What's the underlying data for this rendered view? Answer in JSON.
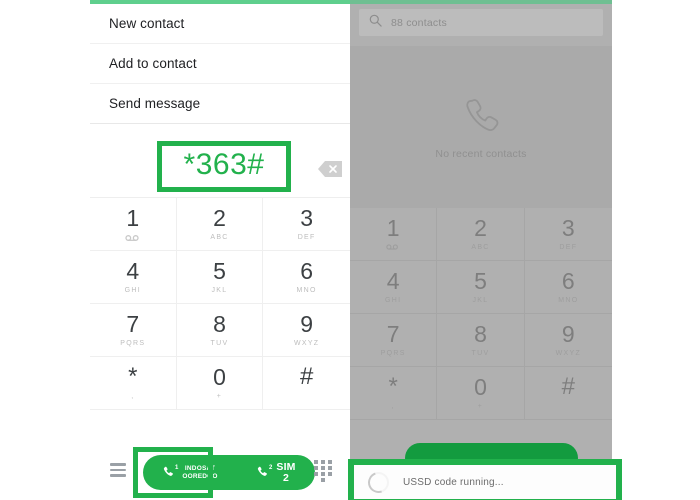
{
  "app": {
    "accent_green": "#22b14c",
    "top_strip_color": "#5fcf8d",
    "scrim_color": "#b0b0b0"
  },
  "suggestions": {
    "items": [
      {
        "label": "New contact"
      },
      {
        "label": "Add to contact"
      },
      {
        "label": "Send message"
      }
    ]
  },
  "number_display": {
    "value": "*363#",
    "backspace_icon": "backspace-icon"
  },
  "keypad": {
    "keys": [
      {
        "digit": "1",
        "sub": "",
        "voicemail": true
      },
      {
        "digit": "2",
        "sub": "ABC"
      },
      {
        "digit": "3",
        "sub": "DEF"
      },
      {
        "digit": "4",
        "sub": "GHI"
      },
      {
        "digit": "5",
        "sub": "JKL"
      },
      {
        "digit": "6",
        "sub": "MNO"
      },
      {
        "digit": "7",
        "sub": "PQRS"
      },
      {
        "digit": "8",
        "sub": "TUV"
      },
      {
        "digit": "9",
        "sub": "WXYZ"
      },
      {
        "digit": "*",
        "sub": ","
      },
      {
        "digit": "0",
        "sub": "+"
      },
      {
        "digit": "#",
        "sub": ""
      }
    ]
  },
  "action_bar": {
    "menu_icon": "hamburger-menu-icon",
    "dialpad_icon": "dialpad-grid-icon",
    "sim1": {
      "line1": "INDOSAT",
      "line2": "OOREDOO",
      "superscript": "1",
      "call_icon": "phone-handset-icon"
    },
    "sim2": {
      "line1": "SIM",
      "line2": "2",
      "superscript": "2",
      "call_icon": "phone-handset-icon"
    }
  },
  "contacts_panel": {
    "search": {
      "value": "88 contacts",
      "icon": "search-icon"
    },
    "empty_state": {
      "icon": "phone-handset-outline-icon",
      "label": "No recent contacts"
    }
  },
  "ussd_dialog": {
    "message": "USSD code running...",
    "spinner": "loading-spinner-icon"
  }
}
